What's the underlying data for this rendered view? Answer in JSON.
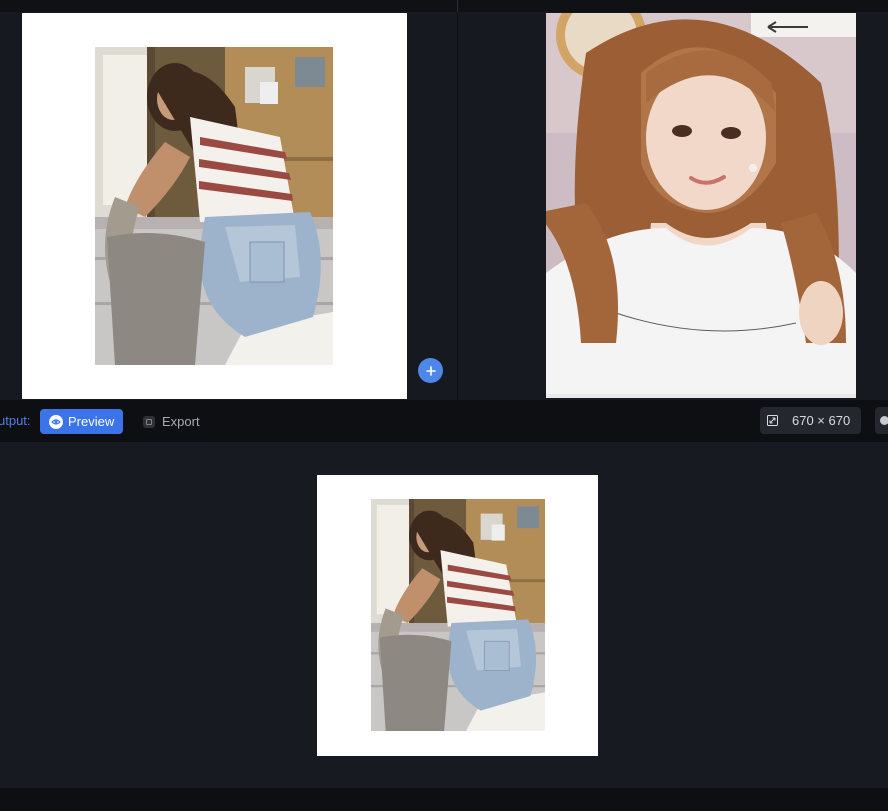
{
  "output_bar": {
    "label": "utput:",
    "preview_label": "Preview",
    "export_label": "Export",
    "size_label": "670 × 670"
  },
  "icons": {
    "add": "plus-icon",
    "preview": "eye-icon",
    "export": "export-icon",
    "size": "resize-icon"
  },
  "colors": {
    "accent": "#3a74e8",
    "add_button": "#4f86ea",
    "background": "#161a20",
    "bar": "#0e0f12"
  }
}
